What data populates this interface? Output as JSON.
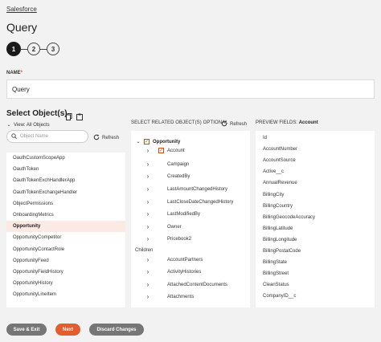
{
  "breadcrumb": "Salesforce",
  "page_title": "Query",
  "stepper": {
    "steps": [
      "1",
      "2",
      "3"
    ],
    "active_index": 0
  },
  "name_field": {
    "label": "NAME",
    "required_mark": "*",
    "value": "Query"
  },
  "select_objects": {
    "title": "Select Object(s)",
    "view_label": "View: All Objects",
    "search_placeholder": "Object Name",
    "refresh_label": "Refresh",
    "items": [
      "OauthCustomScopeApp",
      "OauthToken",
      "OauthTokenExchHandlerApp",
      "OauthTokenExchangeHandler",
      "ObjectPermissions",
      "OnboardingMetrics",
      "Opportunity",
      "OpportunityCompetitor",
      "OpportunityContactRole",
      "OpportunityFeed",
      "OpportunityFieldHistory",
      "OpportunityHistory",
      "OpportunityLineItem"
    ],
    "selected": "Opportunity"
  },
  "related_objects": {
    "title": "SELECT RELATED OBJECT(S) OPTIONAL",
    "refresh_label": "Refresh",
    "root": "Opportunity",
    "parents": [
      "Account",
      "Campaign",
      "CreatedBy",
      "LastAmountChangedHistory",
      "LastCloseDateChangedHistory",
      "LastModifiedBy",
      "Owner",
      "Pricebook2"
    ],
    "children_label": "Children",
    "children": [
      "AccountPartners",
      "ActivityHistories",
      "AttachedContentDocuments",
      "Attachments"
    ]
  },
  "preview_fields": {
    "title_prefix": "PREVIEW FIELDS:",
    "title_object": "Account",
    "fields": [
      "Id",
      "AccountNumber",
      "AccountSource",
      "Active__c",
      "AnnualRevenue",
      "BillingCity",
      "BillingCountry",
      "BillingGeocodeAccuracy",
      "BillingLatitude",
      "BillingLongitude",
      "BillingPostalCode",
      "BillingState",
      "BillingStreet",
      "CleanStatus",
      "CompanyID__c"
    ]
  },
  "footer": {
    "save_exit": "Save & Exit",
    "next": "Next",
    "discard": "Discard Changes"
  },
  "colors": {
    "accent": "#e45d2e",
    "selected_bg": "#fbe9e4",
    "button_gray": "#767676"
  }
}
